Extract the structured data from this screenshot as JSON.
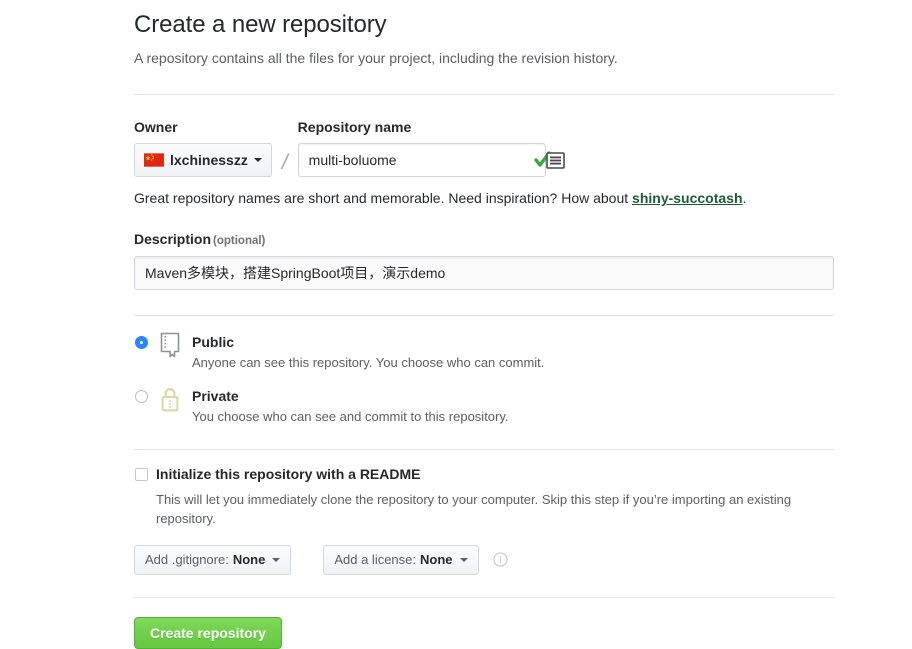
{
  "header": {
    "title": "Create a new repository",
    "subtitle": "A repository contains all the files for your project, including the revision history."
  },
  "owner": {
    "label": "Owner",
    "name": "lxchinesszz",
    "avatar_icon": "china-flag-avatar"
  },
  "separator": "/",
  "repository_name": {
    "label": "Repository name",
    "value": "multi-boluome",
    "placeholder": "",
    "status_icon": "green-check-ime-icon"
  },
  "name_hint": {
    "prefix": "Great repository names are short and memorable. Need inspiration? How about ",
    "suggestion": "shiny-succotash",
    "suffix": "."
  },
  "description": {
    "label": "Description",
    "optional_tag": "(optional)",
    "value": "Maven多模块，搭建SpringBoot项目，演示demo",
    "placeholder": ""
  },
  "visibility": {
    "options": [
      {
        "id": "public",
        "title": "Public",
        "description": "Anyone can see this repository. You choose who can commit.",
        "icon": "repo-book-icon",
        "selected": true
      },
      {
        "id": "private",
        "title": "Private",
        "description": "You choose who can see and commit to this repository.",
        "icon": "lock-icon",
        "selected": false
      }
    ]
  },
  "initialize": {
    "checkbox_label": "Initialize this repository with a README",
    "checked": false,
    "description": "This will let you immediately clone the repository to your computer. Skip this step if you’re importing an existing repository."
  },
  "gitignore": {
    "label": "Add .gitignore:",
    "value": "None"
  },
  "license": {
    "label": "Add a license:",
    "value": "None",
    "info_icon": "info-circle-icon"
  },
  "submit": {
    "label": "Create repository"
  },
  "colors": {
    "accent_blue": "#2188ff",
    "submit_green": "#64c93f",
    "suggestion_green": "#1b5e36",
    "lock_tan": "#dfd8a8",
    "rule_gray": "#e1e4e8",
    "muted_text": "#586069"
  }
}
